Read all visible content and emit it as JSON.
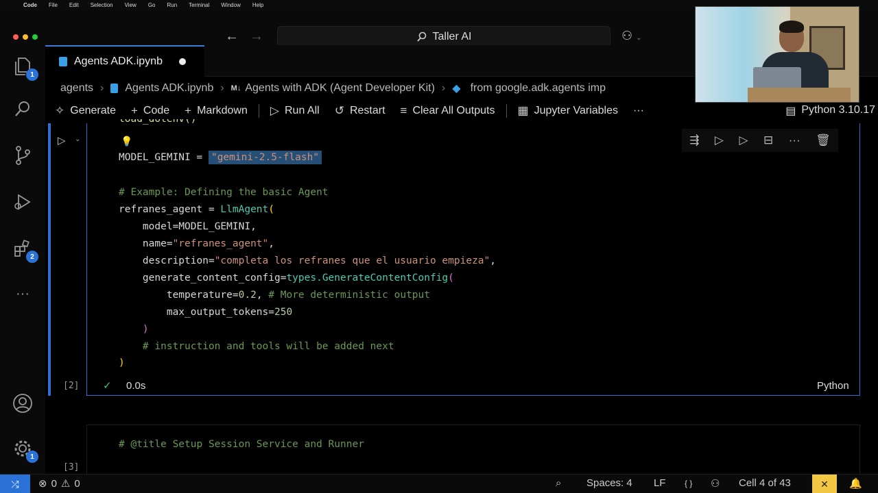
{
  "menubar": {
    "app": "Code",
    "items": [
      "File",
      "Edit",
      "Selection",
      "View",
      "Go",
      "Run",
      "Terminal",
      "Window",
      "Help"
    ]
  },
  "titlebar": {
    "search_text": "Taller AI"
  },
  "activitybar": {
    "explorer_badge": "1",
    "extensions_badge": "2",
    "settings_badge": "1"
  },
  "tab": {
    "title": "Agents ADK.ipynb"
  },
  "breadcrumbs": {
    "folder": "agents",
    "file": "Agents ADK.ipynb",
    "md_tag": "M↓",
    "section": "Agents with ADK (Agent Developer Kit)",
    "symbol": "from google.adk.agents imp"
  },
  "toolbar": {
    "generate": "Generate",
    "code": "Code",
    "markdown": "Markdown",
    "run_all": "Run All",
    "restart": "Restart",
    "clear_outputs": "Clear All Outputs",
    "variables": "Jupyter Variables",
    "more": "···",
    "kernel": "Python 3.10.17"
  },
  "cell": {
    "lines": {
      "l0": "load_dotenv()",
      "l1_var": "MODEL_GEMINI",
      "l1_eq": " = ",
      "l1_val": "\"gemini-2.5-flash\"",
      "l2": "# Example: Defining the basic Agent",
      "l3_var": "refranes_agent",
      "l3_eq": " = ",
      "l3_cls": "LlmAgent",
      "l4_key": "    model=",
      "l4_val": "MODEL_GEMINI",
      "l5_key": "    name=",
      "l5_val": "\"refranes_agent\"",
      "l6_key": "    description=",
      "l6_val": "\"completa los refranes que el usuario empieza\"",
      "l7_key": "    generate_content_config=",
      "l7_mod": "types.",
      "l7_cls": "GenerateContentConfig",
      "l8_key": "        temperature=",
      "l8_val": "0.2",
      "l8_cm": "# More deterministic output",
      "l9_key": "        max_output_tokens=",
      "l9_val": "250",
      "l10": "    )",
      "l11": "    # instruction and tools will be added next",
      "l12": ")"
    },
    "exec_count": "[2]",
    "exec_time": "0.0s",
    "language": "Python"
  },
  "cell2": {
    "code": "# @title Setup Session Service and Runner",
    "exec_count": "[3]"
  },
  "statusbar": {
    "errors": "0",
    "warnings": "0",
    "spaces": "Spaces: 4",
    "eol": "LF",
    "braces": "{ }",
    "cell_position": "Cell 4 of 43"
  },
  "colors": {
    "accent": "#2f6fd1",
    "badge": "#2a72d6",
    "string": "#ce9178",
    "comment": "#6a9955",
    "class": "#4ec9b0",
    "function": "#dcdcaa"
  }
}
